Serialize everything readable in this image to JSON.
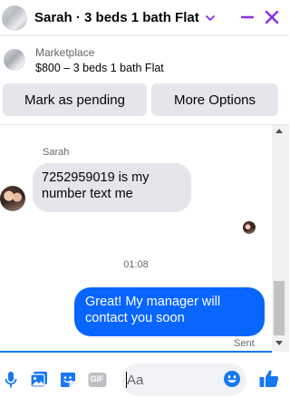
{
  "header": {
    "title": "Sarah · 3 beds 1 bath Flat",
    "icons": [
      "listing-thumbnail",
      "chevron-down-icon",
      "minimize-icon",
      "close-icon"
    ]
  },
  "marketplace": {
    "label": "Marketplace",
    "listing": "$800 – 3 beds 1 bath Flat",
    "buttons": {
      "pending": "Mark as pending",
      "more": "More Options"
    }
  },
  "chat": {
    "sender_name": "Sarah",
    "messages": [
      {
        "from": "Sarah",
        "text": "7252959019 is my number text me"
      },
      {
        "from": "me",
        "text": "Great! My manager will contact you soon"
      }
    ],
    "timestamp": "01:08",
    "status": "Sent"
  },
  "composer": {
    "placeholder": "Aa",
    "icons": [
      "microphone-icon",
      "photo-icon",
      "sticker-icon",
      "gif-icon",
      "emoji-icon",
      "thumbs-up-icon"
    ],
    "gif_label": "GIF"
  },
  "colors": {
    "accent": "#0866ff",
    "brand_purple": "#8a2be2",
    "bubble_in": "#e4e6eb",
    "composer_icon": "#1877f2"
  }
}
